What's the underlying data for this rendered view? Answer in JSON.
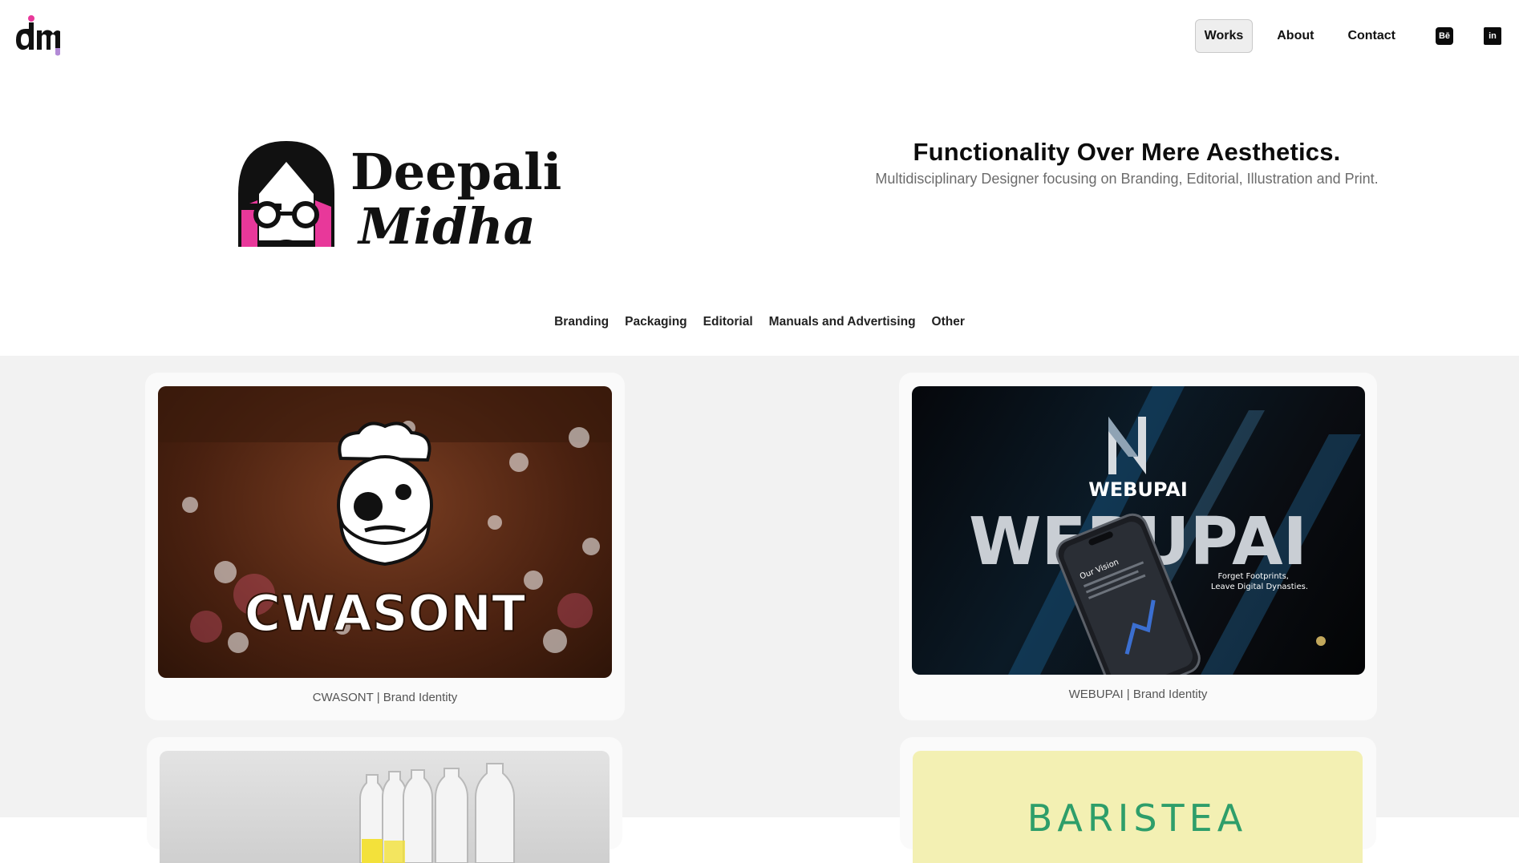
{
  "header": {
    "logo_alt": "dm",
    "nav": [
      {
        "label": "Works",
        "active": true
      },
      {
        "label": "About",
        "active": false
      },
      {
        "label": "Contact",
        "active": false
      }
    ],
    "social": [
      {
        "name": "behance-icon",
        "glyph": "Bē"
      },
      {
        "name": "linkedin-icon",
        "glyph": "in"
      }
    ]
  },
  "hero": {
    "logo_line1": "Deepali",
    "logo_line2": "Midha",
    "headline": "Functionality Over Mere Aesthetics.",
    "subheadline": "Multidisciplinary Designer focusing on Branding, Editorial, Illustration and Print."
  },
  "categories": [
    "Branding",
    "Packaging",
    "Editorial",
    "Manuals and Advertising",
    "Other"
  ],
  "projects": [
    {
      "title": "CWASONT | Brand Identity",
      "image_text": "CWASONT"
    },
    {
      "title": "WEBUPAI | Brand Identity",
      "image_text": "WEBUPAI",
      "image_small": "WEBUPAI",
      "image_tag": "Forget Footprints,\nLeave Digital Dynasties.",
      "phone_text": "Our Vision"
    },
    {
      "title": "",
      "image_text": ""
    },
    {
      "title": "",
      "image_text": "BARISTEA"
    }
  ],
  "colors": {
    "accent_pink": "#e8389a",
    "grid_bg": "#f2f2f2",
    "card_bg": "#fafafa"
  }
}
